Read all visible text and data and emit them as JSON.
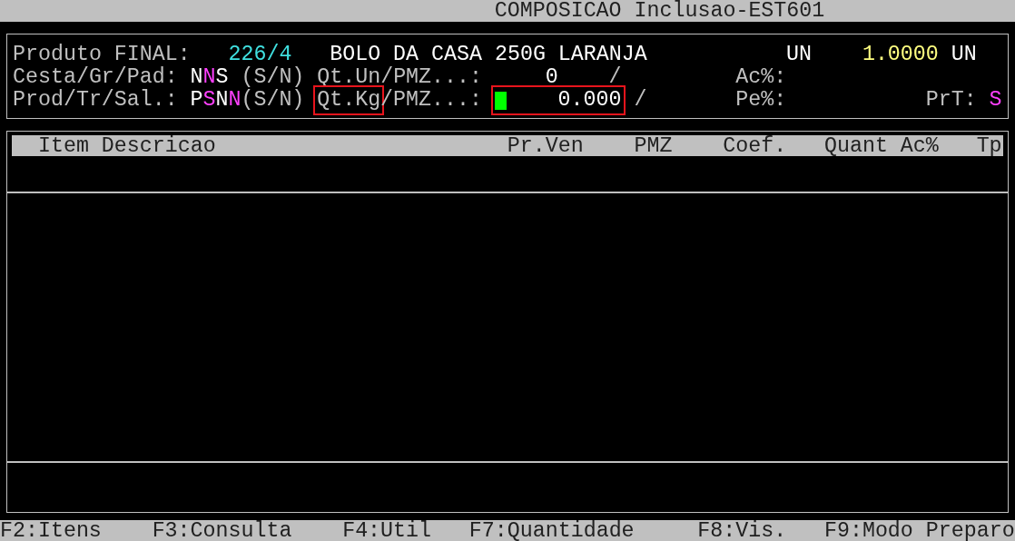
{
  "title": "COMPOSICAO Inclusao-EST601",
  "form": {
    "lines": [
      {
        "segments": [
          {
            "kind": "label",
            "text": "Produto FINAL:",
            "marked": false
          },
          {
            "kind": "value",
            "text": "226/4",
            "color": "#40e0e0",
            "marked": false
          },
          {
            "kind": "value",
            "text": "BOLO DA CASA 250G LARANJA",
            "color": "#ffffff",
            "marked": false
          },
          {
            "kind": "value",
            "text": "UN",
            "color": "#ffffff",
            "marked": false
          },
          {
            "kind": "value",
            "text": "1.0000",
            "color": "#ffff80",
            "marked": false
          },
          {
            "kind": "value",
            "text": "UN",
            "color": "#ffffff",
            "marked": false
          }
        ]
      },
      {
        "segments": [
          {
            "kind": "label",
            "text": "Cesta/Gr/Pad:",
            "marked": false
          },
          {
            "kind": "flags",
            "letters": [
              {
                "text": "N",
                "color": "#ffffff"
              },
              {
                "text": "N",
                "color": "#ff40ff"
              },
              {
                "text": "S",
                "color": "#ffffff"
              }
            ],
            "marked": false
          },
          {
            "kind": "label",
            "text": "(S/N)",
            "marked": false
          },
          {
            "kind": "label",
            "text": "Qt.Un/PMZ...:",
            "marked": false
          },
          {
            "kind": "value",
            "text": "0",
            "color": "#ffffff",
            "marked": false
          },
          {
            "kind": "label",
            "text": "/",
            "marked": false
          },
          {
            "kind": "label",
            "text": "Ac%:",
            "marked": false
          }
        ]
      },
      {
        "segments": [
          {
            "kind": "label",
            "text": "Prod/Tr/Sal.:",
            "marked": false
          },
          {
            "kind": "flags",
            "letters": [
              {
                "text": "P",
                "color": "#ffffff"
              },
              {
                "text": "S",
                "color": "#ff40ff"
              },
              {
                "text": "N",
                "color": "#ffffff"
              },
              {
                "text": "N",
                "color": "#ff40ff"
              }
            ],
            "marked": false
          },
          {
            "kind": "label",
            "text": "(S/N)",
            "marked": false
          },
          {
            "kind": "label",
            "text": "Qt.Kg",
            "marked": true
          },
          {
            "kind": "label",
            "text": "/PMZ...:",
            "marked": false
          },
          {
            "kind": "input",
            "text": "0.000",
            "cursor": true,
            "marked": true
          },
          {
            "kind": "label",
            "text": "/",
            "marked": false
          },
          {
            "kind": "label",
            "text": "Pe%:",
            "marked": false
          },
          {
            "kind": "label",
            "text": "PrT:",
            "marked": false
          },
          {
            "kind": "value",
            "text": "S",
            "color": "#ff40ff",
            "marked": false
          }
        ]
      }
    ]
  },
  "table": {
    "columns": [
      {
        "label": "Item Descricao"
      },
      {
        "label": "Pr.Ven"
      },
      {
        "label": "PMZ"
      },
      {
        "label": "Coef."
      },
      {
        "label": "Quant"
      },
      {
        "label": "Ac%"
      },
      {
        "label": "Tp"
      }
    ]
  },
  "function_keys": [
    {
      "label": "F2:Itens"
    },
    {
      "label": "F3:Consulta"
    },
    {
      "label": "F4:Util"
    },
    {
      "label": "F7:Quantidade"
    },
    {
      "label": "F8:Vis."
    },
    {
      "label": "F9:Modo Preparo"
    }
  ]
}
